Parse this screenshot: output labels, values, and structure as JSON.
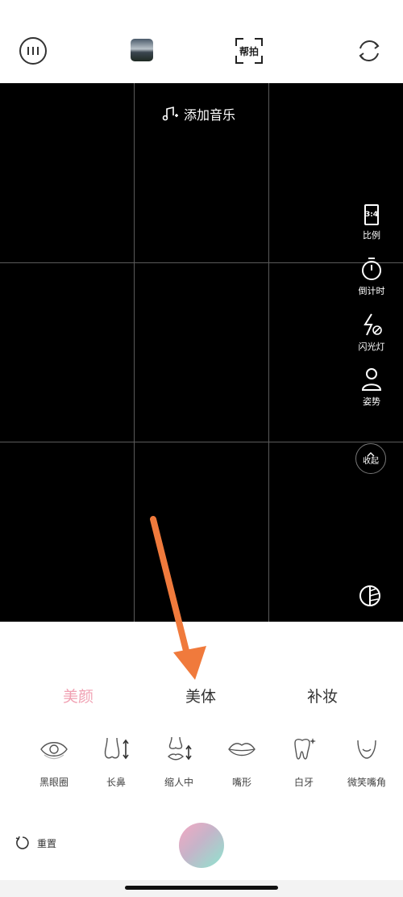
{
  "topbar": {
    "help_label": "帮拍"
  },
  "viewfinder": {
    "music_label": "添加音乐",
    "tools": [
      {
        "label": "比例",
        "badge": "3:4"
      },
      {
        "label": "倒计时"
      },
      {
        "label": "闪光灯"
      },
      {
        "label": "姿势"
      }
    ],
    "collapse_label": "收起"
  },
  "panel": {
    "categories": [
      {
        "label": "美颜",
        "active": true
      },
      {
        "label": "美体"
      },
      {
        "label": "补妆"
      }
    ],
    "items": [
      {
        "label": "黑眼圈",
        "icon": "eye-icon"
      },
      {
        "label": "长鼻",
        "icon": "nose-length-icon"
      },
      {
        "label": "缩人中",
        "icon": "philtrum-icon"
      },
      {
        "label": "嘴形",
        "icon": "lips-icon"
      },
      {
        "label": "白牙",
        "icon": "tooth-icon"
      },
      {
        "label": "微笑嘴角",
        "icon": "smile-corner-icon"
      }
    ],
    "reset_label": "重置"
  },
  "colors": {
    "active_tab": "#f0a0b2",
    "annotation_arrow": "#f07a3c"
  }
}
